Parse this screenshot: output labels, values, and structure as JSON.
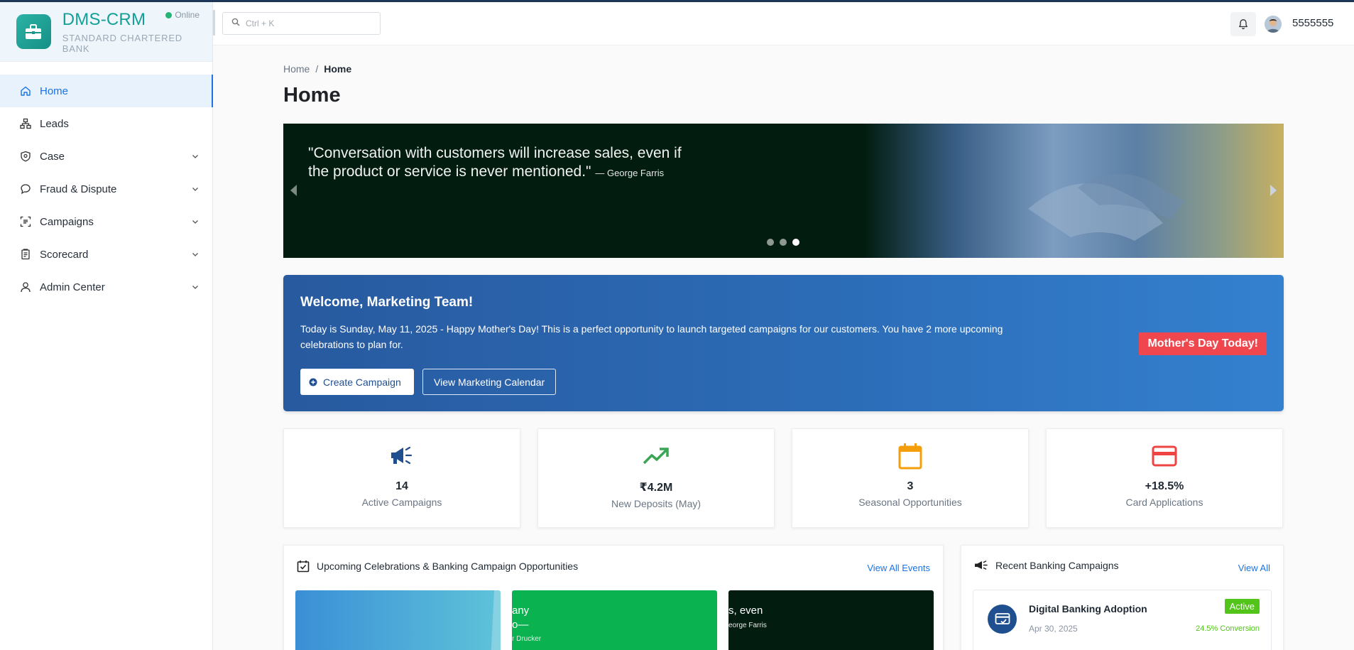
{
  "app": {
    "name": "DMS-CRM",
    "subtitle": "STANDARD CHARTERED BANK",
    "status": "Online"
  },
  "sidebar": {
    "items": [
      {
        "label": "Home",
        "icon": "home-icon",
        "active": true
      },
      {
        "label": "Leads",
        "icon": "hierarchy-icon"
      },
      {
        "label": "Case",
        "icon": "shield-icon",
        "expandable": true
      },
      {
        "label": "Fraud & Dispute",
        "icon": "chat-icon",
        "expandable": true
      },
      {
        "label": "Campaigns",
        "icon": "campaign-icon",
        "expandable": true
      },
      {
        "label": "Scorecard",
        "icon": "clipboard-icon",
        "expandable": true
      },
      {
        "label": "Admin Center",
        "icon": "user-icon",
        "expandable": true
      }
    ]
  },
  "header": {
    "search_placeholder": "Ctrl + K",
    "username": "5555555"
  },
  "breadcrumb": {
    "root": "Home",
    "separator": "/",
    "current": "Home"
  },
  "page_title": "Home",
  "banner": {
    "quote": "\"Conversation with customers will increase sales, even if the product or service is never mentioned.\"",
    "author": "— George Farris",
    "active_slide": 3,
    "slide_count": 3
  },
  "welcome": {
    "title": "Welcome, Marketing Team!",
    "message": "Today is Sunday, May 11, 2025 - Happy Mother's Day! This is a perfect opportunity to launch targeted campaigns for our customers. You have 2 more upcoming celebrations to plan for.",
    "create_button": "Create Campaign",
    "calendar_button": "View Marketing Calendar",
    "badge": "Mother's Day Today!"
  },
  "stats": [
    {
      "value": "14",
      "label": "Active Campaigns",
      "icon": "megaphone-icon",
      "color": "#1f4f8f"
    },
    {
      "value": "₹4.2M",
      "label": "New Deposits (May)",
      "icon": "trending-up-icon",
      "color": "#3aa655"
    },
    {
      "value": "3",
      "label": "Seasonal Opportunities",
      "icon": "calendar-icon",
      "color": "#f59e0b"
    },
    {
      "value": "+18.5%",
      "label": "Card Applications",
      "icon": "credit-card-icon",
      "color": "#ef4444"
    }
  ],
  "events_panel": {
    "title": "Upcoming Celebrations & Banking Campaign Opportunities",
    "link": "View All Events",
    "thumbs": [
      {
        "text_a": "",
        "text_b": ""
      },
      {
        "text_a": "any",
        "text_b": "o—",
        "small": "r Drucker"
      },
      {
        "text_a": "s, even",
        "small": "eorge Farris"
      }
    ]
  },
  "campaigns_panel": {
    "title": "Recent Banking Campaigns",
    "link": "View All",
    "items": [
      {
        "title": "Digital Banking Adoption",
        "date": "Apr 30, 2025",
        "status": "Active",
        "conversion": "24.5% Conversion"
      }
    ]
  }
}
